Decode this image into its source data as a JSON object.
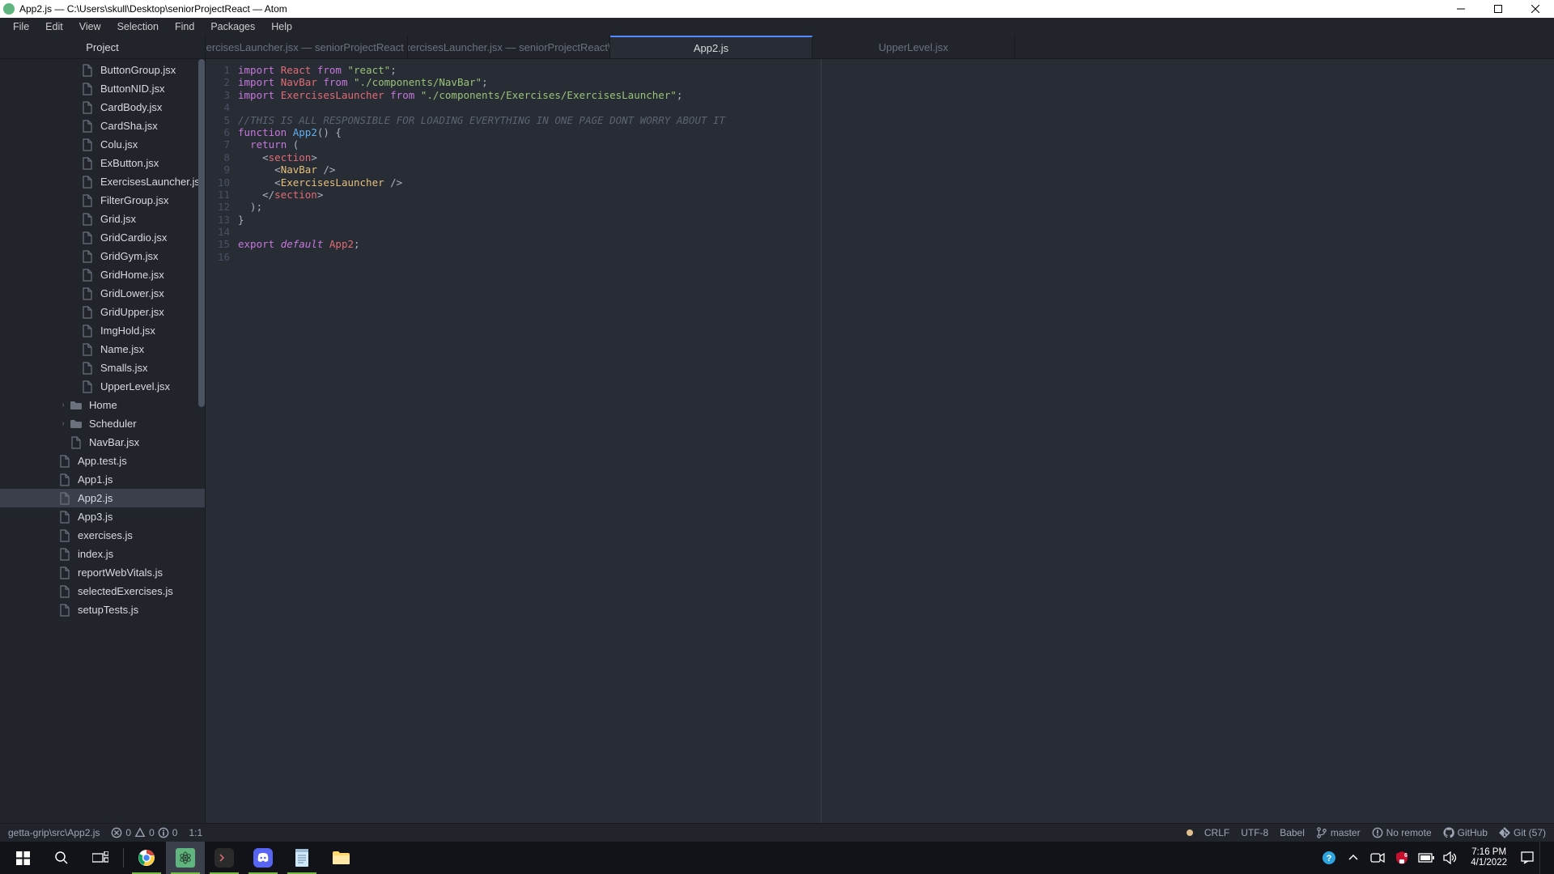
{
  "title_bar": "App2.js — C:\\Users\\skull\\Desktop\\seniorProjectReact — Atom",
  "menu": [
    "File",
    "Edit",
    "View",
    "Selection",
    "Find",
    "Packages",
    "Help"
  ],
  "sidebar_header": "Project",
  "tree": [
    {
      "type": "file",
      "name": "ButtonGroup.jsx",
      "indent": 100
    },
    {
      "type": "file",
      "name": "ButtonNID.jsx",
      "indent": 100
    },
    {
      "type": "file",
      "name": "CardBody.jsx",
      "indent": 100
    },
    {
      "type": "file",
      "name": "CardSha.jsx",
      "indent": 100
    },
    {
      "type": "file",
      "name": "Colu.jsx",
      "indent": 100
    },
    {
      "type": "file",
      "name": "ExButton.jsx",
      "indent": 100
    },
    {
      "type": "file",
      "name": "ExercisesLauncher.jsx",
      "indent": 100
    },
    {
      "type": "file",
      "name": "FilterGroup.jsx",
      "indent": 100
    },
    {
      "type": "file",
      "name": "Grid.jsx",
      "indent": 100
    },
    {
      "type": "file",
      "name": "GridCardio.jsx",
      "indent": 100
    },
    {
      "type": "file",
      "name": "GridGym.jsx",
      "indent": 100
    },
    {
      "type": "file",
      "name": "GridHome.jsx",
      "indent": 100
    },
    {
      "type": "file",
      "name": "GridLower.jsx",
      "indent": 100
    },
    {
      "type": "file",
      "name": "GridUpper.jsx",
      "indent": 100
    },
    {
      "type": "file",
      "name": "ImgHold.jsx",
      "indent": 100
    },
    {
      "type": "file",
      "name": "Name.jsx",
      "indent": 100
    },
    {
      "type": "file",
      "name": "Smalls.jsx",
      "indent": 100
    },
    {
      "type": "file",
      "name": "UpperLevel.jsx",
      "indent": 100
    },
    {
      "type": "folder",
      "name": "Home",
      "indent": 72,
      "collapsed": true
    },
    {
      "type": "folder",
      "name": "Scheduler",
      "indent": 72,
      "collapsed": true
    },
    {
      "type": "file",
      "name": "NavBar.jsx",
      "indent": 86
    },
    {
      "type": "file",
      "name": "App.test.js",
      "indent": 72
    },
    {
      "type": "file",
      "name": "App1.js",
      "indent": 72
    },
    {
      "type": "file",
      "name": "App2.js",
      "indent": 72,
      "selected": true
    },
    {
      "type": "file",
      "name": "App3.js",
      "indent": 72
    },
    {
      "type": "file",
      "name": "exercises.js",
      "indent": 72
    },
    {
      "type": "file",
      "name": "index.js",
      "indent": 72
    },
    {
      "type": "file",
      "name": "reportWebVitals.js",
      "indent": 72
    },
    {
      "type": "file",
      "name": "selectedExercises.js",
      "indent": 72
    },
    {
      "type": "file",
      "name": "setupTests.js",
      "indent": 72
    }
  ],
  "tabs": [
    {
      "label": "ExercisesLauncher.jsx — seniorProjectReact -..."
    },
    {
      "label": "ExercisesLauncher.jsx — seniorProjectReact\\..."
    },
    {
      "label": "App2.js",
      "active": true
    },
    {
      "label": "UpperLevel.jsx"
    }
  ],
  "code_lines": [
    [
      {
        "c": "k",
        "t": "import"
      },
      {
        "t": " "
      },
      {
        "c": "cr",
        "t": "React"
      },
      {
        "t": " "
      },
      {
        "c": "k",
        "t": "from"
      },
      {
        "t": " "
      },
      {
        "c": "s",
        "t": "\"react\""
      },
      {
        "t": ";"
      }
    ],
    [
      {
        "c": "k",
        "t": "import"
      },
      {
        "t": " "
      },
      {
        "c": "cr",
        "t": "NavBar"
      },
      {
        "t": " "
      },
      {
        "c": "k",
        "t": "from"
      },
      {
        "t": " "
      },
      {
        "c": "s",
        "t": "\"./components/NavBar\""
      },
      {
        "t": ";"
      }
    ],
    [
      {
        "c": "k",
        "t": "import"
      },
      {
        "t": " "
      },
      {
        "c": "cr",
        "t": "ExercisesLauncher"
      },
      {
        "t": " "
      },
      {
        "c": "k",
        "t": "from"
      },
      {
        "t": " "
      },
      {
        "c": "s",
        "t": "\"./components/Exercises/ExercisesLauncher\""
      },
      {
        "t": ";"
      }
    ],
    [],
    [
      {
        "c": "cm",
        "t": "//THIS IS ALL RESPONSIBLE FOR LOADING EVERYTHING IN ONE PAGE DONT WORRY ABOUT IT"
      }
    ],
    [
      {
        "c": "k",
        "t": "function"
      },
      {
        "t": " "
      },
      {
        "c": "fn",
        "t": "App2"
      },
      {
        "t": "() {"
      }
    ],
    [
      {
        "t": "  "
      },
      {
        "c": "k",
        "t": "return"
      },
      {
        "t": " ("
      }
    ],
    [
      {
        "t": "    <"
      },
      {
        "c": "tg",
        "t": "section"
      },
      {
        "t": ">"
      }
    ],
    [
      {
        "t": "      <"
      },
      {
        "c": "cn",
        "t": "NavBar"
      },
      {
        "t": " "
      },
      {
        "t": "/>"
      }
    ],
    [
      {
        "t": "      <"
      },
      {
        "c": "cn",
        "t": "ExercisesLauncher"
      },
      {
        "t": " "
      },
      {
        "t": "/>"
      }
    ],
    [
      {
        "t": "    </"
      },
      {
        "c": "tg",
        "t": "section"
      },
      {
        "t": ">"
      }
    ],
    [
      {
        "t": "  );"
      }
    ],
    [
      {
        "t": "}"
      }
    ],
    [],
    [
      {
        "c": "k",
        "t": "export"
      },
      {
        "t": " "
      },
      {
        "c": "kd",
        "t": "default"
      },
      {
        "t": " "
      },
      {
        "c": "cr",
        "t": "App2"
      },
      {
        "t": ";"
      }
    ],
    []
  ],
  "status": {
    "path": "getta-grip\\src\\App2.js",
    "diag_err": "0",
    "diag_warn": "0",
    "diag_info": "0",
    "cursor": "1:1",
    "linebreak": "CRLF",
    "encoding": "UTF-8",
    "grammar": "Babel",
    "branch": "master",
    "remote": "No remote",
    "github": "GitHub",
    "git": "Git (57)"
  },
  "taskbar_time": "7:16 PM",
  "taskbar_date": "4/1/2022"
}
